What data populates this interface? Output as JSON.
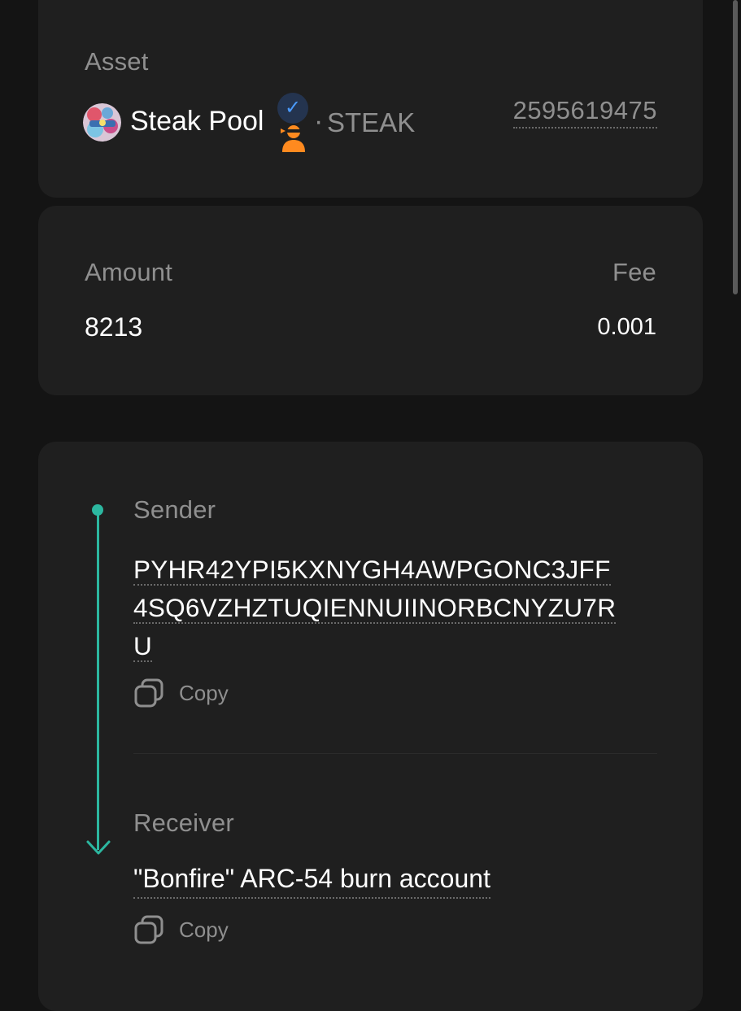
{
  "asset": {
    "label": "Asset",
    "name": "Steak Pool",
    "separator": "·",
    "ticker": "STEAK",
    "asset_id": "2595619475",
    "verified_icon": "checkmark-icon"
  },
  "amount": {
    "label": "Amount",
    "value": "8213",
    "fee_label": "Fee",
    "fee_value": "0.001"
  },
  "transfer": {
    "sender_label": "Sender",
    "sender_address_lines": [
      "PYHR42YPI5KXNYGH4AWPGONC3JFF",
      "4SQ6VZHZTUQIENNUIINORBCNYZU7R",
      "U"
    ],
    "copy_label": "Copy",
    "receiver_label": "Receiver",
    "receiver_name": "\"Bonfire\" ARC-54 burn account",
    "accent_color": "#2cb7a0"
  }
}
